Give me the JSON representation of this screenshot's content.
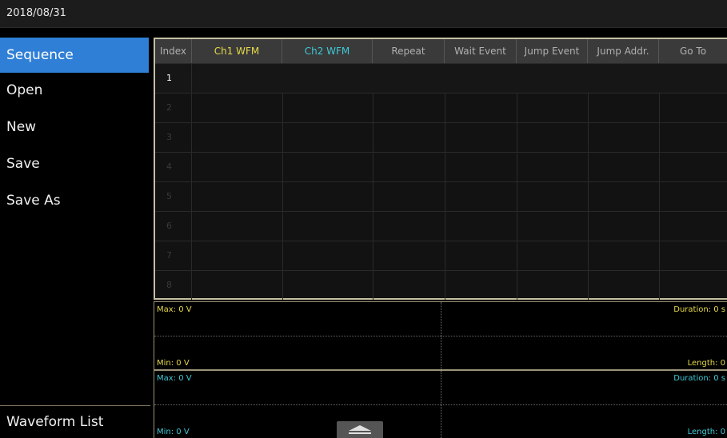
{
  "topbar": {
    "date": "2018/08/31"
  },
  "sidebar": {
    "items": [
      {
        "label": "Sequence",
        "selected": true
      },
      {
        "label": "Open"
      },
      {
        "label": "New"
      },
      {
        "label": "Save"
      },
      {
        "label": "Save As"
      }
    ],
    "bottom_label": "Waveform List"
  },
  "table": {
    "headers": [
      "Index",
      "Ch1 WFM",
      "Ch2 WFM",
      "Repeat",
      "Wait Event",
      "Jump Event",
      "Jump Addr.",
      "Go To"
    ],
    "rows": [
      "1",
      "2",
      "3",
      "4",
      "5",
      "6",
      "7",
      "8"
    ]
  },
  "waves": {
    "ch1": {
      "max": "Max: 0 V",
      "min": "Min: 0 V",
      "duration": "Duration: 0 s",
      "length": "Length: 0"
    },
    "ch2": {
      "max": "Max: 0 V",
      "min": "Min: 0 V",
      "duration": "Duration: 0 s",
      "length": "Length: 0"
    }
  },
  "colors": {
    "accent": "#2f7fd6",
    "ch1": "#e6d94a",
    "ch2": "#3fc9d6",
    "border": "#c6bfa4"
  },
  "icons": {
    "expand": "chevron-up-icon"
  }
}
